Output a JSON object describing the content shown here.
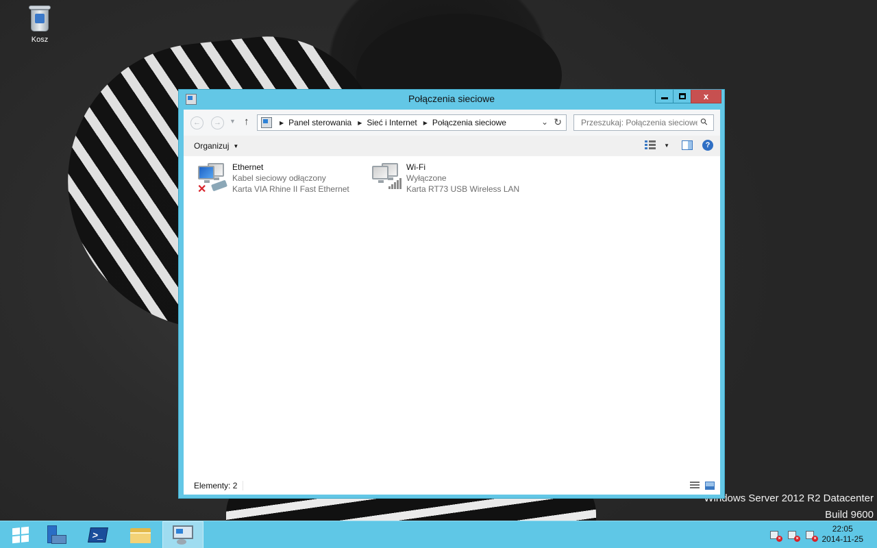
{
  "desktop": {
    "recycle_bin_label": "Kosz",
    "watermark_line1": "Windows Server 2012 R2 Datacenter",
    "watermark_line2": "Build 9600"
  },
  "window": {
    "title": "Połączenia sieciowe",
    "controls": {
      "minimize": "minimize",
      "maximize": "maximize",
      "close": "x"
    }
  },
  "address_bar": {
    "breadcrumbs": [
      "Panel sterowania",
      "Sieć i Internet",
      "Połączenia sieciowe"
    ]
  },
  "search": {
    "placeholder": "Przeszukaj: Połączenia sieciowe"
  },
  "command_bar": {
    "organize_label": "Organizuj"
  },
  "connections": [
    {
      "name": "Ethernet",
      "status": "Kabel sieciowy odłączony",
      "adapter": "Karta VIA Rhine II Fast Ethernet",
      "icon": "ethernet-disconnected-icon"
    },
    {
      "name": "Wi-Fi",
      "status": "Wyłączone",
      "adapter": "Karta RT73 USB Wireless LAN",
      "icon": "wifi-disabled-icon"
    }
  ],
  "status_bar": {
    "item_count": "Elementy: 2"
  },
  "taskbar": {
    "pinned": [
      "start-icon",
      "server-manager-icon",
      "powershell-icon",
      "file-explorer-icon",
      "control-panel-icon"
    ],
    "clock_time": "22:05",
    "clock_date": "2014-11-25"
  },
  "colors": {
    "accent": "#63c7e6",
    "taskbar": "#5fc7e6",
    "close_button": "#c75050"
  }
}
